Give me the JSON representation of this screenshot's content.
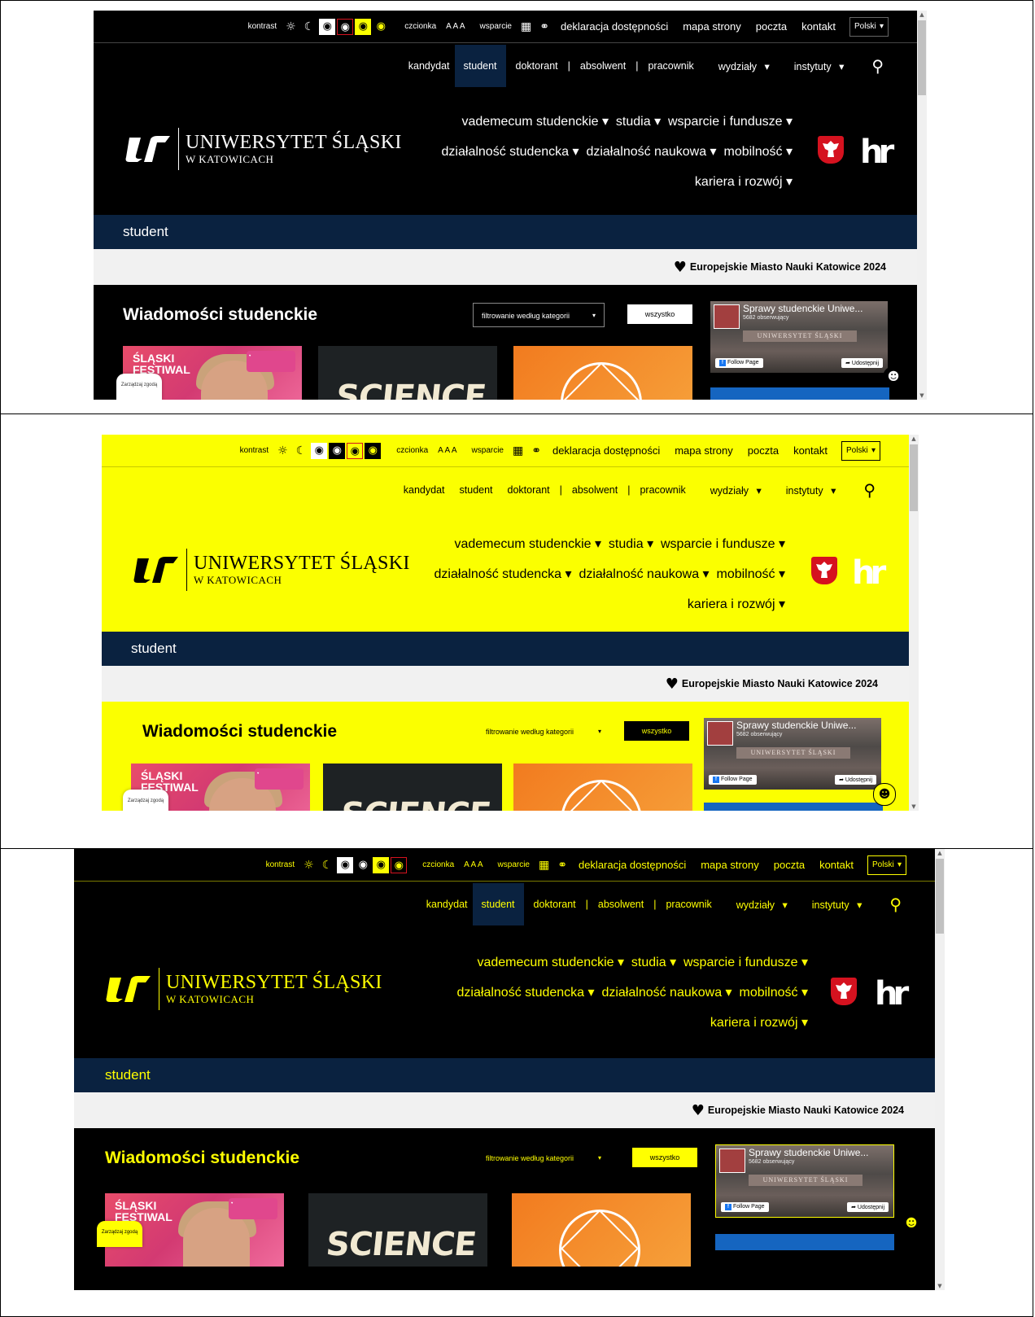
{
  "panels": [
    {
      "theme": "normal",
      "util": {
        "kontrast": "kontrast",
        "czcionka": "czcionka",
        "aaa": "A A A",
        "wsparcie": "wsparcie",
        "deklaracja": "deklaracja dostępności",
        "mapa": "mapa strony",
        "poczta": "poczta",
        "kontakt": "kontakt",
        "lang": "Polski"
      },
      "nav": {
        "kandydat": "kandydat",
        "student": "student",
        "doktorant": "doktorant",
        "sep1": "|",
        "absolwent": "absolwent",
        "sep2": "|",
        "pracownik": "pracownik",
        "wydzialy": "wydziały",
        "instytuty": "instytuty"
      },
      "logo": {
        "line1": "UNIWERSYTET ŚLĄSKI",
        "line2": "W KATOWICACH"
      },
      "mainnav": [
        "vademecum studenckie",
        "studia",
        "wsparcie i fundusze",
        "działalność studencka",
        "działalność naukowa",
        "mobilność",
        "kariera i rozwój"
      ],
      "band": "student",
      "emn": "Europejskie Miasto Nauki Katowice 2024",
      "news": {
        "heading": "Wiadomości studenckie",
        "filter": "filtrowanie według kategorii",
        "all": "wszystko"
      },
      "fb": {
        "name": "Sprawy studenckie Uniwe...",
        "followers": "5682 obserwujący",
        "banner": "UNIWERSYTET ŚLĄSKI",
        "follow": "Follow Page",
        "share": "Udostępnij"
      },
      "cards": {
        "festival_1": "ŚLĄSKI",
        "festival_2": "FESTIWAL",
        "science": "SCIENCE"
      },
      "consent": "Zarządzaj zgodą"
    },
    {
      "theme": "yellow",
      "util": {
        "kontrast": "kontrast",
        "czcionka": "czcionka",
        "aaa": "A A A",
        "wsparcie": "wsparcie",
        "deklaracja": "deklaracja dostępności",
        "mapa": "mapa strony",
        "poczta": "poczta",
        "kontakt": "kontakt",
        "lang": "Polski"
      },
      "nav": {
        "kandydat": "kandydat",
        "student": "student",
        "doktorant": "doktorant",
        "sep1": "|",
        "absolwent": "absolwent",
        "sep2": "|",
        "pracownik": "pracownik",
        "wydzialy": "wydziały",
        "instytuty": "instytuty"
      },
      "logo": {
        "line1": "UNIWERSYTET ŚLĄSKI",
        "line2": "W KATOWICACH"
      },
      "mainnav": [
        "vademecum studenckie",
        "studia",
        "wsparcie i fundusze",
        "działalność studencka",
        "działalność naukowa",
        "mobilność",
        "kariera i rozwój"
      ],
      "band": "student",
      "emn": "Europejskie Miasto Nauki Katowice 2024",
      "news": {
        "heading": "Wiadomości studenckie",
        "filter": "filtrowanie według kategorii",
        "all": "wszystko"
      },
      "fb": {
        "name": "Sprawy studenckie Uniwe...",
        "followers": "5682 obserwujący",
        "banner": "UNIWERSYTET ŚLĄSKI",
        "follow": "Follow Page",
        "share": "Udostępnij"
      },
      "cards": {
        "festival_1": "ŚLĄSKI",
        "festival_2": "FESTIWAL",
        "science": "SCIENCE"
      },
      "consent": "Zarządzaj zgodą"
    },
    {
      "theme": "dark-yellow",
      "util": {
        "kontrast": "kontrast",
        "czcionka": "czcionka",
        "aaa": "A A A",
        "wsparcie": "wsparcie",
        "deklaracja": "deklaracja dostępności",
        "mapa": "mapa strony",
        "poczta": "poczta",
        "kontakt": "kontakt",
        "lang": "Polski"
      },
      "nav": {
        "kandydat": "kandydat",
        "student": "student",
        "doktorant": "doktorant",
        "sep1": "|",
        "absolwent": "absolwent",
        "sep2": "|",
        "pracownik": "pracownik",
        "wydzialy": "wydziały",
        "instytuty": "instytuty"
      },
      "logo": {
        "line1": "UNIWERSYTET ŚLĄSKI",
        "line2": "W KATOWICACH"
      },
      "mainnav": [
        "vademecum studenckie",
        "studia",
        "wsparcie i fundusze",
        "działalność studencka",
        "działalność naukowa",
        "mobilność",
        "kariera i rozwój"
      ],
      "band": "student",
      "emn": "Europejskie Miasto Nauki Katowice 2024",
      "news": {
        "heading": "Wiadomości studenckie",
        "filter": "filtrowanie według kategorii",
        "all": "wszystko"
      },
      "fb": {
        "name": "Sprawy studenckie Uniwe...",
        "followers": "5682 obserwujący",
        "banner": "UNIWERSYTET ŚLĄSKI",
        "follow": "Follow Page",
        "share": "Udostępnij"
      },
      "cards": {
        "festival_1": "ŚLĄSKI",
        "festival_2": "FESTIWAL",
        "science": "SCIENCE"
      },
      "consent": "Zarządzaj zgodą"
    }
  ],
  "colors": {
    "navy": "#0a2240",
    "yellow": "#fbff00",
    "dark_yellow_text": "#ffff00",
    "black": "#000000",
    "red": "#d5121f"
  },
  "icons": {
    "sun": "sun-icon",
    "moon": "moon-icon",
    "eye": "eye-icon",
    "sitemap": "sitemap-icon",
    "link": "link-icon",
    "search": "search-icon",
    "heart": "heart-icon",
    "bot": "bot-icon",
    "caret": "caret-down-icon"
  }
}
